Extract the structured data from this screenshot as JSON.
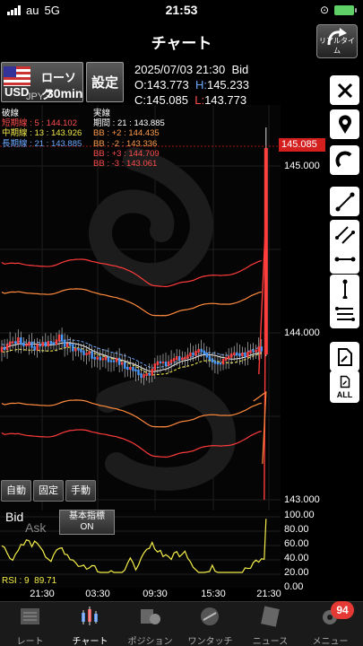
{
  "status": {
    "carrier": "au",
    "network": "5G",
    "time": "21:53"
  },
  "nav": {
    "title": "チャート",
    "realtime_label": "リアルタイム"
  },
  "symbol": {
    "base": "USD",
    "quote": "JPY",
    "chart_type": "ローソク",
    "period": "30min"
  },
  "settings_label": "設定",
  "quote": {
    "datetime": "2025/07/03 21:30",
    "side": "Bid",
    "open_label": "O:",
    "open": "143.773",
    "high_label": "H:",
    "high": "145.233",
    "close_label": "C:",
    "close": "145.085",
    "low_label": "L:",
    "low": "143.773"
  },
  "legend_left": {
    "header": "破線",
    "rows": [
      {
        "label": "短期線",
        "period": "5",
        "value": "144.102",
        "color": "#ff4d4d"
      },
      {
        "label": "中期線",
        "period": "13",
        "value": "143.926",
        "color": "#f0e64a"
      },
      {
        "label": "長期線",
        "period": "21",
        "value": "143.885",
        "color": "#6aa8ff"
      }
    ]
  },
  "legend_right": {
    "header": "実線",
    "period_row": {
      "label": "期間",
      "period": "21",
      "value": "143.885"
    },
    "rows": [
      {
        "label": "BB",
        "sigma": "+2",
        "value": "144.435",
        "color": "#ff9a4a"
      },
      {
        "label": "BB",
        "sigma": "-2",
        "value": "143.336",
        "color": "#ff9a4a"
      },
      {
        "label": "BB",
        "sigma": "+3",
        "value": "144.709",
        "color": "#ff4d4d"
      },
      {
        "label": "BB",
        "sigma": "-3",
        "value": "143.061",
        "color": "#ff4d4d"
      }
    ]
  },
  "price_axis": {
    "current": "145.085",
    "ticks": [
      "145.000",
      "144.000",
      "143.000"
    ]
  },
  "chart_buttons": {
    "auto": "自動",
    "fixed": "固定",
    "manual": "手動"
  },
  "rsi_panel": {
    "bid": "Bid",
    "ask": "Ask",
    "kihon_line1": "基本指標",
    "kihon_line2": "ON",
    "label": "RSI : 9",
    "value": "89.71",
    "ticks": [
      "100.00",
      "80.00",
      "60.00",
      "40.00",
      "20.00",
      "0.00"
    ]
  },
  "time_axis": [
    "21:30",
    "03:30",
    "09:30",
    "15:30",
    "21:30"
  ],
  "toolbar": [
    "close-icon",
    "pin-icon",
    "magnet-icon",
    "line-icon",
    "parallel-line-icon",
    "horizontal-line-icon",
    "vertical-line-icon",
    "fibonacci-icon",
    "delete-icon",
    "delete-all-icon"
  ],
  "toolbar_all_label": "ALL",
  "tabs": [
    {
      "label": "レート",
      "icon": "rate-icon"
    },
    {
      "label": "チャート",
      "icon": "chart-icon"
    },
    {
      "label": "ポジション",
      "icon": "position-icon"
    },
    {
      "label": "ワンタッチ",
      "icon": "sell-buy-icon"
    },
    {
      "label": "ニュース",
      "icon": "news-icon"
    },
    {
      "label": "メニュー",
      "icon": "menu-icon"
    }
  ],
  "menu_badge": "94",
  "chart_data": {
    "type": "candlestick",
    "x": [
      "21:30",
      "03:30",
      "09:30",
      "15:30",
      "21:30"
    ],
    "ylim": [
      143.0,
      145.3
    ],
    "last": {
      "open": 143.773,
      "high": 145.233,
      "low": 143.773,
      "close": 145.085
    },
    "rsi": {
      "period": 9,
      "last": 89.71,
      "ylim": [
        0,
        100
      ]
    }
  }
}
